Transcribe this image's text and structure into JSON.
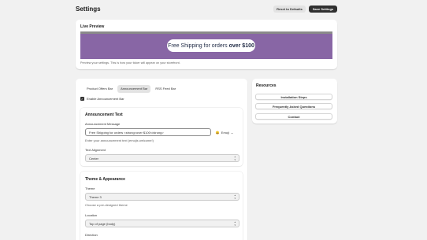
{
  "header": {
    "title": "Settings",
    "reset_label": "Reset to Defaults",
    "save_label": "Save Settings"
  },
  "preview": {
    "title": "Live Preview",
    "bar_text": "Free Shipping for orders",
    "bar_text_strong": "over $100",
    "help": "Preview your settings. This is how your ticker will appear on your storefront.",
    "bar_color": "#8866a5"
  },
  "tabs": [
    {
      "label": "Product Offers Bar",
      "active": false
    },
    {
      "label": "Announcement Bar",
      "active": true
    },
    {
      "label": "RSS Feed Bar",
      "active": false
    }
  ],
  "enable": {
    "label": "Enable Announcement Bar",
    "checked": true
  },
  "announcement_text": {
    "heading": "Announcement Text",
    "message_label": "Announcement Message",
    "message_value": "Free Shipping for orders <strong>over $100</strong>",
    "emoji_label": "Emoji",
    "help": "Enter your announcement text (emojis welcome!)",
    "alignment_label": "Text Alignment",
    "alignment_value": "Center"
  },
  "theme": {
    "heading": "Theme & Appearance",
    "theme_label": "Theme",
    "theme_value": "Theme 3",
    "theme_help": "Choose a pre-designed theme",
    "location_label": "Location",
    "location_value": "Top of page (body)",
    "direction_label": "Direction"
  },
  "resources": {
    "title": "Resources",
    "items": [
      "Installation Steps",
      "Frequently Asked Questions",
      "Contact"
    ]
  }
}
